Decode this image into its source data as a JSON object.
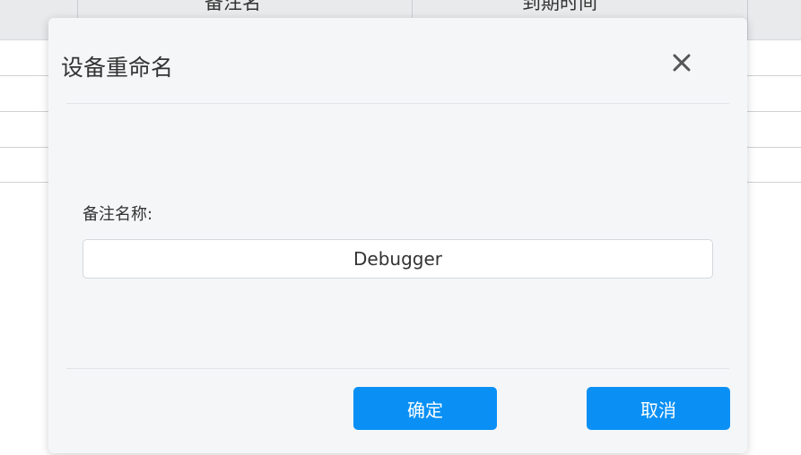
{
  "background_table": {
    "columns": [
      "备注名",
      "到期时间"
    ]
  },
  "dialog": {
    "title": "设备重命名",
    "close_icon": "close-icon",
    "field_label": "备注名称:",
    "name_value": "Debugger",
    "confirm_label": "确定",
    "cancel_label": "取消"
  },
  "colors": {
    "accent": "#0a90f5",
    "dialog_bg": "#f5f6f8",
    "header_bg": "#e9eaec"
  }
}
